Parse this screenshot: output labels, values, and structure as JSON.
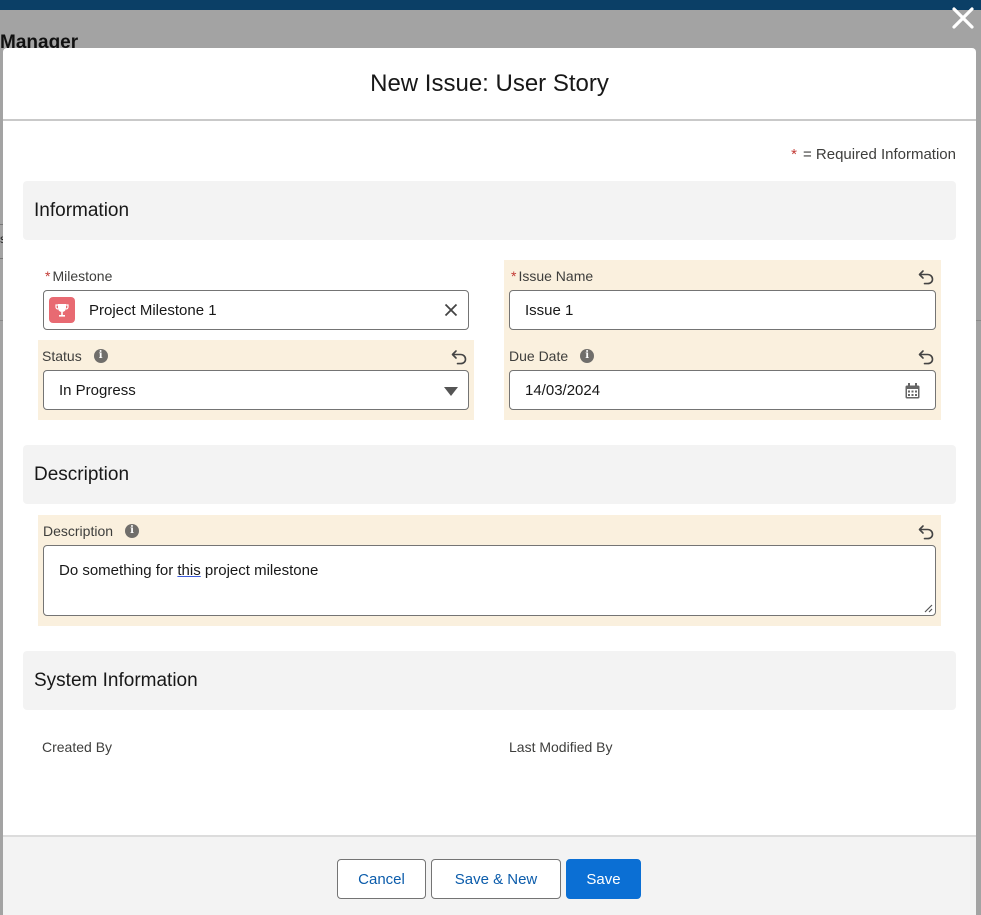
{
  "background": {
    "app_title": "Manager",
    "stray_char": "s"
  },
  "modal": {
    "title": "New Issue: User Story",
    "required_note": "= Required Information",
    "required_star": "*",
    "sections": {
      "information": "Information",
      "description": "Description",
      "system_information": "System Information"
    },
    "fields": {
      "milestone": {
        "label": "Milestone",
        "value": "Project Milestone 1",
        "icon": "trophy-icon"
      },
      "issue_name": {
        "label": "Issue Name",
        "value": "Issue 1"
      },
      "status": {
        "label": "Status",
        "value": "In Progress"
      },
      "due_date": {
        "label": "Due Date",
        "value": "14/03/2024"
      },
      "description": {
        "label": "Description",
        "value_before": "Do something for ",
        "value_underlined": "this",
        "value_after": " project milestone"
      },
      "created_by": {
        "label": "Created By"
      },
      "last_modified_by": {
        "label": "Last Modified By"
      }
    },
    "buttons": {
      "cancel": "Cancel",
      "save_new": "Save & New",
      "save": "Save"
    }
  },
  "colors": {
    "brand": "#0b6fd4",
    "dirty_field_bg": "#faf0de",
    "required_star": "#c23934",
    "milestone_icon_bg": "#e86a72"
  }
}
